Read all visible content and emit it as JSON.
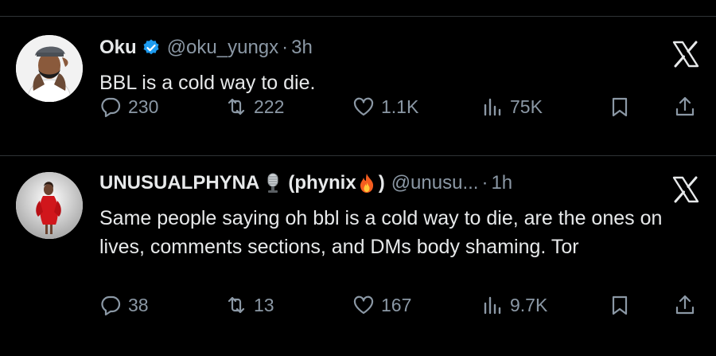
{
  "tweets": [
    {
      "name": "Oku",
      "handle": "@oku_yungx",
      "separator": "·",
      "time": "3h",
      "text": "BBL is a cold way to die.",
      "replies": "230",
      "retweets": "222",
      "likes": "1.1K",
      "views": "75K"
    },
    {
      "name": "UNUSUALPHYNA",
      "name_suffix_open": "(phynix",
      "name_suffix_close": ")",
      "handle": "@unusu...",
      "separator": "·",
      "time": "1h",
      "text": "Same people saying oh bbl is a cold way to die, are the ones on lives, comments sections, and DMs body shaming. Tor",
      "replies": "38",
      "retweets": "13",
      "likes": "167",
      "views": "9.7K"
    }
  ],
  "icons": {
    "verified": "verified-badge-icon",
    "logo": "x-logo-icon",
    "reply": "reply-icon",
    "retweet": "retweet-icon",
    "like": "heart-icon",
    "views": "views-icon",
    "bookmark": "bookmark-icon",
    "share": "share-icon",
    "name_emoji_1": "microphone-icon",
    "name_emoji_2": "fire-icon"
  },
  "colors": {
    "background": "#000000",
    "text": "#e7e9ea",
    "muted": "#8b98a5",
    "verified": "#1d9bf0",
    "divider": "#2f3336"
  }
}
